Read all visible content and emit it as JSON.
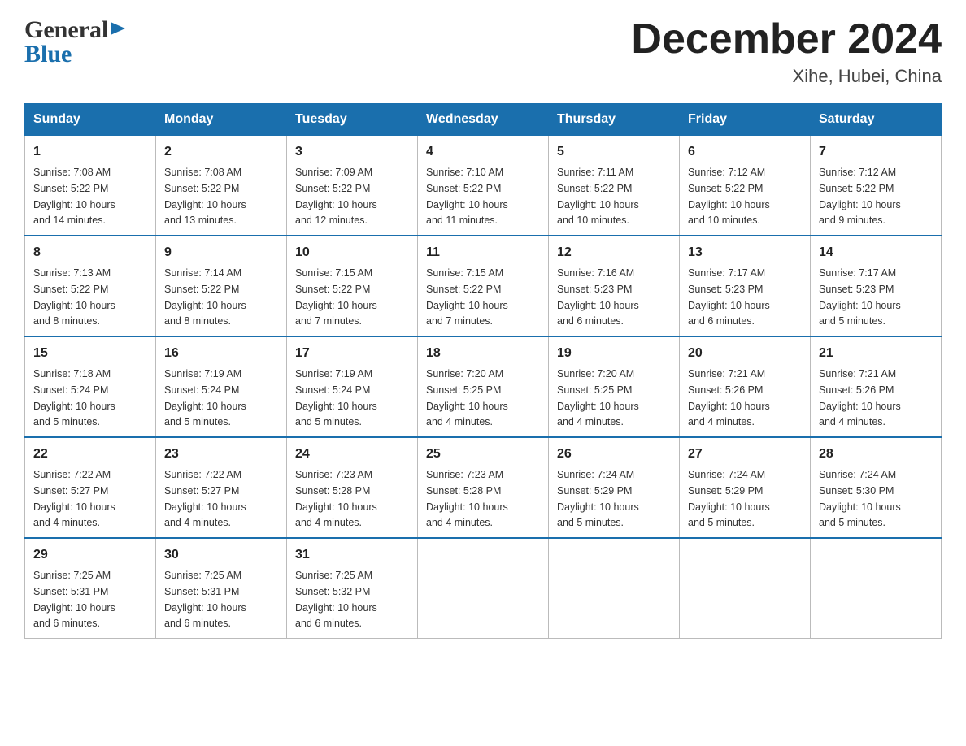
{
  "logo": {
    "line1": "General",
    "line2": "Blue"
  },
  "header": {
    "title": "December 2024",
    "location": "Xihe, Hubei, China"
  },
  "days_of_week": [
    "Sunday",
    "Monday",
    "Tuesday",
    "Wednesday",
    "Thursday",
    "Friday",
    "Saturday"
  ],
  "weeks": [
    [
      {
        "day": "1",
        "sunrise": "7:08 AM",
        "sunset": "5:22 PM",
        "daylight": "10 hours and 14 minutes."
      },
      {
        "day": "2",
        "sunrise": "7:08 AM",
        "sunset": "5:22 PM",
        "daylight": "10 hours and 13 minutes."
      },
      {
        "day": "3",
        "sunrise": "7:09 AM",
        "sunset": "5:22 PM",
        "daylight": "10 hours and 12 minutes."
      },
      {
        "day": "4",
        "sunrise": "7:10 AM",
        "sunset": "5:22 PM",
        "daylight": "10 hours and 11 minutes."
      },
      {
        "day": "5",
        "sunrise": "7:11 AM",
        "sunset": "5:22 PM",
        "daylight": "10 hours and 10 minutes."
      },
      {
        "day": "6",
        "sunrise": "7:12 AM",
        "sunset": "5:22 PM",
        "daylight": "10 hours and 10 minutes."
      },
      {
        "day": "7",
        "sunrise": "7:12 AM",
        "sunset": "5:22 PM",
        "daylight": "10 hours and 9 minutes."
      }
    ],
    [
      {
        "day": "8",
        "sunrise": "7:13 AM",
        "sunset": "5:22 PM",
        "daylight": "10 hours and 8 minutes."
      },
      {
        "day": "9",
        "sunrise": "7:14 AM",
        "sunset": "5:22 PM",
        "daylight": "10 hours and 8 minutes."
      },
      {
        "day": "10",
        "sunrise": "7:15 AM",
        "sunset": "5:22 PM",
        "daylight": "10 hours and 7 minutes."
      },
      {
        "day": "11",
        "sunrise": "7:15 AM",
        "sunset": "5:22 PM",
        "daylight": "10 hours and 7 minutes."
      },
      {
        "day": "12",
        "sunrise": "7:16 AM",
        "sunset": "5:23 PM",
        "daylight": "10 hours and 6 minutes."
      },
      {
        "day": "13",
        "sunrise": "7:17 AM",
        "sunset": "5:23 PM",
        "daylight": "10 hours and 6 minutes."
      },
      {
        "day": "14",
        "sunrise": "7:17 AM",
        "sunset": "5:23 PM",
        "daylight": "10 hours and 5 minutes."
      }
    ],
    [
      {
        "day": "15",
        "sunrise": "7:18 AM",
        "sunset": "5:24 PM",
        "daylight": "10 hours and 5 minutes."
      },
      {
        "day": "16",
        "sunrise": "7:19 AM",
        "sunset": "5:24 PM",
        "daylight": "10 hours and 5 minutes."
      },
      {
        "day": "17",
        "sunrise": "7:19 AM",
        "sunset": "5:24 PM",
        "daylight": "10 hours and 5 minutes."
      },
      {
        "day": "18",
        "sunrise": "7:20 AM",
        "sunset": "5:25 PM",
        "daylight": "10 hours and 4 minutes."
      },
      {
        "day": "19",
        "sunrise": "7:20 AM",
        "sunset": "5:25 PM",
        "daylight": "10 hours and 4 minutes."
      },
      {
        "day": "20",
        "sunrise": "7:21 AM",
        "sunset": "5:26 PM",
        "daylight": "10 hours and 4 minutes."
      },
      {
        "day": "21",
        "sunrise": "7:21 AM",
        "sunset": "5:26 PM",
        "daylight": "10 hours and 4 minutes."
      }
    ],
    [
      {
        "day": "22",
        "sunrise": "7:22 AM",
        "sunset": "5:27 PM",
        "daylight": "10 hours and 4 minutes."
      },
      {
        "day": "23",
        "sunrise": "7:22 AM",
        "sunset": "5:27 PM",
        "daylight": "10 hours and 4 minutes."
      },
      {
        "day": "24",
        "sunrise": "7:23 AM",
        "sunset": "5:28 PM",
        "daylight": "10 hours and 4 minutes."
      },
      {
        "day": "25",
        "sunrise": "7:23 AM",
        "sunset": "5:28 PM",
        "daylight": "10 hours and 4 minutes."
      },
      {
        "day": "26",
        "sunrise": "7:24 AM",
        "sunset": "5:29 PM",
        "daylight": "10 hours and 5 minutes."
      },
      {
        "day": "27",
        "sunrise": "7:24 AM",
        "sunset": "5:29 PM",
        "daylight": "10 hours and 5 minutes."
      },
      {
        "day": "28",
        "sunrise": "7:24 AM",
        "sunset": "5:30 PM",
        "daylight": "10 hours and 5 minutes."
      }
    ],
    [
      {
        "day": "29",
        "sunrise": "7:25 AM",
        "sunset": "5:31 PM",
        "daylight": "10 hours and 6 minutes."
      },
      {
        "day": "30",
        "sunrise": "7:25 AM",
        "sunset": "5:31 PM",
        "daylight": "10 hours and 6 minutes."
      },
      {
        "day": "31",
        "sunrise": "7:25 AM",
        "sunset": "5:32 PM",
        "daylight": "10 hours and 6 minutes."
      },
      null,
      null,
      null,
      null
    ]
  ],
  "labels": {
    "sunrise": "Sunrise:",
    "sunset": "Sunset:",
    "daylight": "Daylight:"
  }
}
